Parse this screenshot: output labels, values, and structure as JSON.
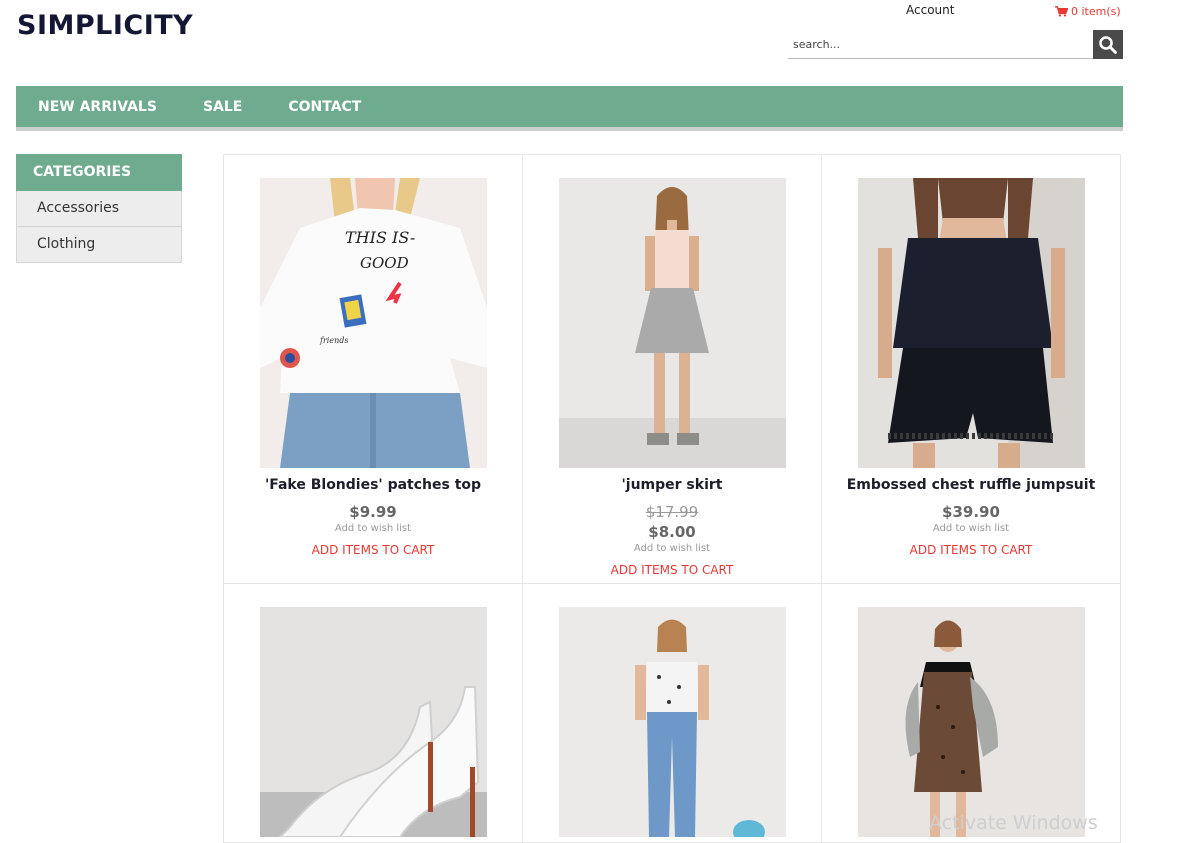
{
  "header": {
    "logo": "SIMPLICITY",
    "account_label": "Account",
    "cart_label": "0 item(s)",
    "search_placeholder": "search..."
  },
  "nav": {
    "items": [
      {
        "label": "NEW ARRIVALS"
      },
      {
        "label": "SALE"
      },
      {
        "label": "CONTACT"
      }
    ]
  },
  "sidebar": {
    "title": "CATEGORIES",
    "items": [
      {
        "label": "Accessories"
      },
      {
        "label": "Clothing"
      }
    ]
  },
  "products": [
    {
      "name": "'Fake Blondies' patches top",
      "price": "$9.99",
      "wish": "Add to wish list",
      "cta": "ADD ITEMS TO CART"
    },
    {
      "name": "'jumper skirt",
      "old_price": "$17.99",
      "price": "$8.00",
      "wish": "Add to wish list",
      "cta": "ADD ITEMS TO CART"
    },
    {
      "name": "Embossed chest ruffle jumpsuit",
      "price": "$39.90",
      "wish": "Add to wish list",
      "cta": "ADD ITEMS TO CART"
    }
  ],
  "watermark": "Activate Windows",
  "colors": {
    "accent_green": "#6fab8e",
    "cart_red": "#e53935",
    "logo_navy": "#141733"
  }
}
